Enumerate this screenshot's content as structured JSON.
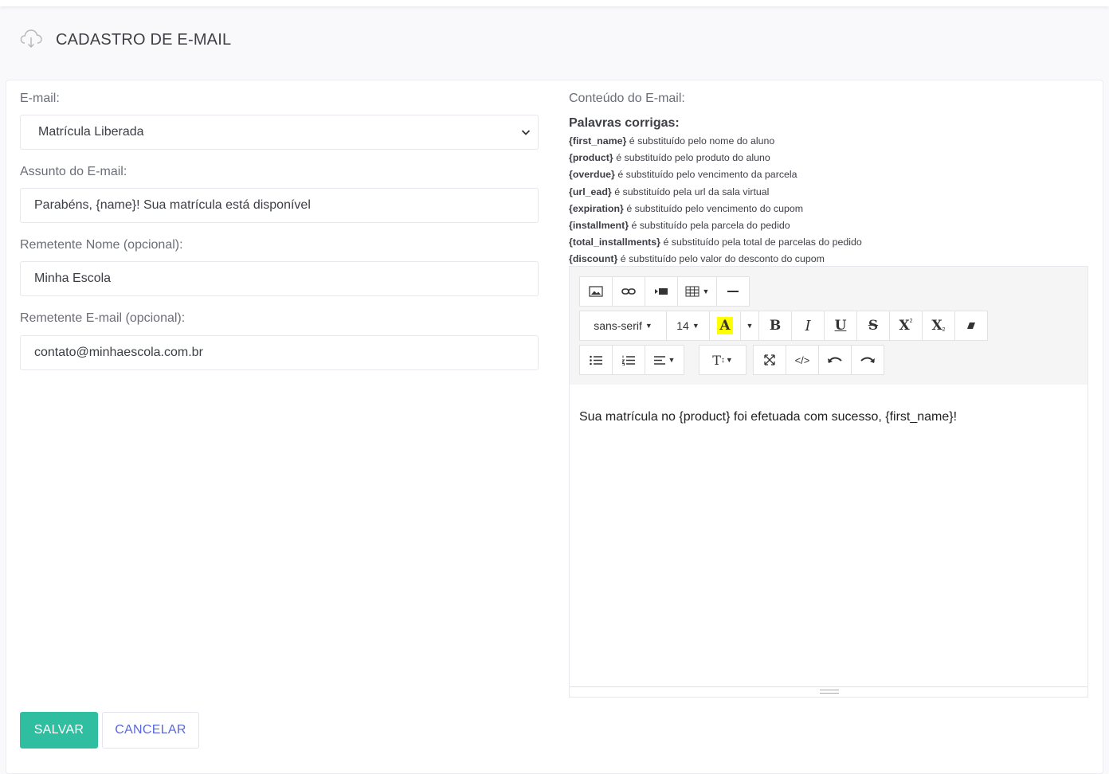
{
  "page": {
    "title": "CADASTRO DE E-MAIL"
  },
  "form": {
    "email_label": "E-mail:",
    "email_selected": "Matrícula Liberada",
    "subject_label": "Assunto do E-mail:",
    "subject_value": "Parabéns, {name}! Sua matrícula está disponível",
    "sender_name_label": "Remetente Nome (opcional):",
    "sender_name_value": "Minha Escola",
    "sender_email_label": "Remetente E-mail (opcional):",
    "sender_email_value": "contato@minhaescola.com.br"
  },
  "content": {
    "label": "Conteúdo do E-mail:",
    "words_title": "Palavras corrigas:",
    "words": [
      {
        "key": "{first_name}",
        "desc": "é substituído pelo nome do aluno"
      },
      {
        "key": "{product}",
        "desc": "é substituído pelo produto do aluno"
      },
      {
        "key": "{overdue}",
        "desc": "é substituído pelo vencimento da parcela"
      },
      {
        "key": "{url_ead}",
        "desc": "é substituído pela url da sala virtual"
      },
      {
        "key": "{expiration}",
        "desc": "é substituído pelo vencimento do cupom"
      },
      {
        "key": "{installment}",
        "desc": "é substituído pela parcela do pedido"
      },
      {
        "key": "{total_installments}",
        "desc": "é substituído pela total de parcelas do pedido"
      },
      {
        "key": "{discount}",
        "desc": "é substituído pelo valor do desconto do cupom"
      }
    ]
  },
  "editor": {
    "font_family": "sans-serif",
    "font_size": "14",
    "body_text": "Sua matrícula no {product} foi efetuada com sucesso, {first_name}!",
    "highlight_color": "#ffff00",
    "toolbar_row1_icons": [
      "image-icon",
      "link-icon",
      "video-icon",
      "table-icon",
      "horizontal-rule-icon"
    ],
    "toolbar_row2_icons": [
      "font-family-dropdown",
      "font-size-dropdown",
      "text-color-icon",
      "color-dropdown-caret",
      "bold-icon",
      "italic-icon",
      "underline-icon",
      "strikethrough-icon",
      "superscript-icon",
      "subscript-icon",
      "eraser-icon"
    ],
    "toolbar_row3_icons": [
      "unordered-list-icon",
      "ordered-list-icon",
      "align-icon",
      "line-height-icon",
      "fullscreen-icon",
      "code-view-icon",
      "undo-icon",
      "redo-icon"
    ],
    "format_labels": {
      "bold": "B",
      "italic": "I",
      "underline": "U",
      "strike": "S",
      "super": "X",
      "sub": "X",
      "textcolor": "A",
      "lineheight": "T"
    }
  },
  "actions": {
    "save": "SALVAR",
    "cancel": "CANCELAR"
  },
  "colors": {
    "save_bg": "#2fbfa0",
    "cancel_text": "#5867dd"
  }
}
